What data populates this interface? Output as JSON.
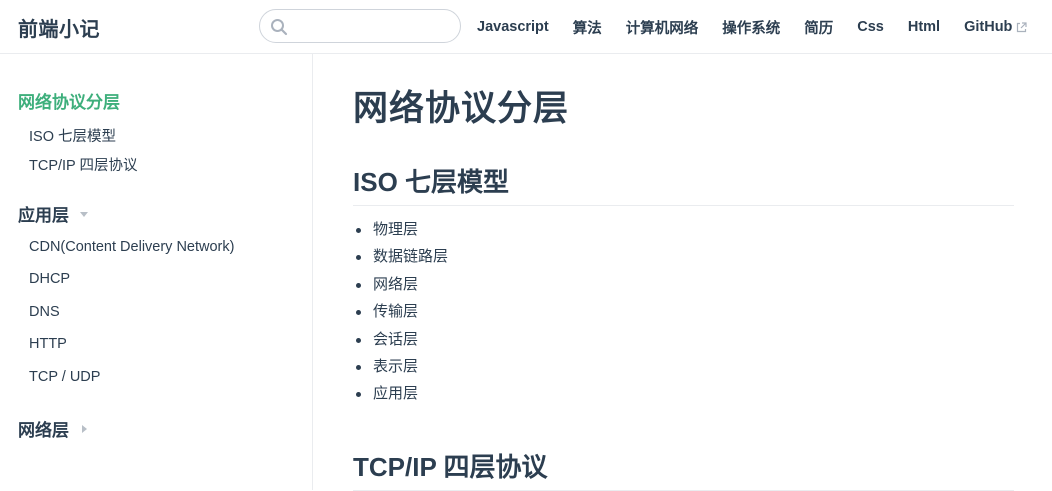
{
  "header": {
    "site_name": "前端小记",
    "search": {
      "value": "",
      "placeholder": ""
    },
    "nav": [
      {
        "label": "Javascript"
      },
      {
        "label": "算法"
      },
      {
        "label": "计算机网络"
      },
      {
        "label": "操作系统"
      },
      {
        "label": "简历"
      },
      {
        "label": "Css"
      },
      {
        "label": "Html"
      },
      {
        "label": "GitHub",
        "external": true
      }
    ]
  },
  "sidebar": {
    "groups": [
      {
        "title": "网络协议分层",
        "active": true,
        "collapsible": false,
        "items": [
          "ISO 七层模型",
          "TCP/IP 四层协议"
        ]
      },
      {
        "title": "应用层",
        "collapsible": true,
        "expanded": true,
        "items": [
          "CDN(Content Delivery Network)",
          "DHCP",
          "DNS",
          "HTTP",
          "TCP / UDP"
        ]
      },
      {
        "title": "网络层",
        "collapsible": true,
        "expanded": false,
        "items": []
      }
    ]
  },
  "main": {
    "title": "网络协议分层",
    "sections": [
      {
        "heading": "ISO 七层模型",
        "items": [
          "物理层",
          "数据链路层",
          "网络层",
          "传输层",
          "会话层",
          "表示层",
          "应用层"
        ]
      },
      {
        "heading": "TCP/IP 四层协议",
        "items": []
      }
    ]
  },
  "colors": {
    "accent": "#3eaf7c",
    "text": "#2c3e50",
    "border": "#eaecef"
  }
}
